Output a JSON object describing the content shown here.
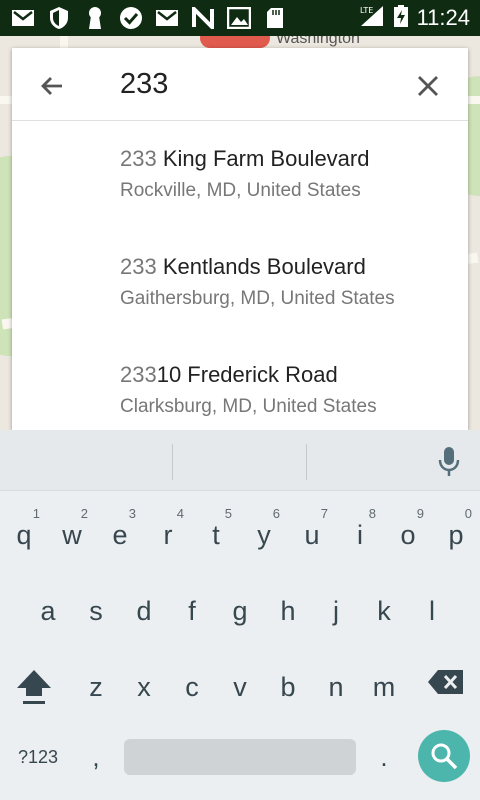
{
  "status_bar": {
    "icons": [
      "gmail-icon",
      "shield-icon",
      "keyhole-icon",
      "check-badge-icon",
      "gmail-icon",
      "n-icon",
      "gallery-icon",
      "sd-card-icon"
    ],
    "network": "LTE",
    "time": "11:24"
  },
  "map": {
    "visible_label": "Washington"
  },
  "search": {
    "query": "233"
  },
  "results": [
    {
      "match": "233",
      "rest": " King Farm Boulevard",
      "subtitle": "Rockville, MD, United States"
    },
    {
      "match": "233",
      "rest": " Kentlands Boulevard",
      "subtitle": "Gaithersburg, MD, United States"
    },
    {
      "match": "233",
      "rest": "10 Frederick Road",
      "subtitle": "Clarksburg, MD, United States"
    }
  ],
  "keyboard": {
    "row1": [
      {
        "key": "q",
        "num": "1"
      },
      {
        "key": "w",
        "num": "2"
      },
      {
        "key": "e",
        "num": "3"
      },
      {
        "key": "r",
        "num": "4"
      },
      {
        "key": "t",
        "num": "5"
      },
      {
        "key": "y",
        "num": "6"
      },
      {
        "key": "u",
        "num": "7"
      },
      {
        "key": "i",
        "num": "8"
      },
      {
        "key": "o",
        "num": "9"
      },
      {
        "key": "p",
        "num": "0"
      }
    ],
    "row2": [
      "a",
      "s",
      "d",
      "f",
      "g",
      "h",
      "j",
      "k",
      "l"
    ],
    "row3": [
      "z",
      "x",
      "c",
      "v",
      "b",
      "n",
      "m"
    ],
    "symbols_label": "?123",
    "comma": ",",
    "period": ".",
    "accent_color": "#4db6ac"
  }
}
